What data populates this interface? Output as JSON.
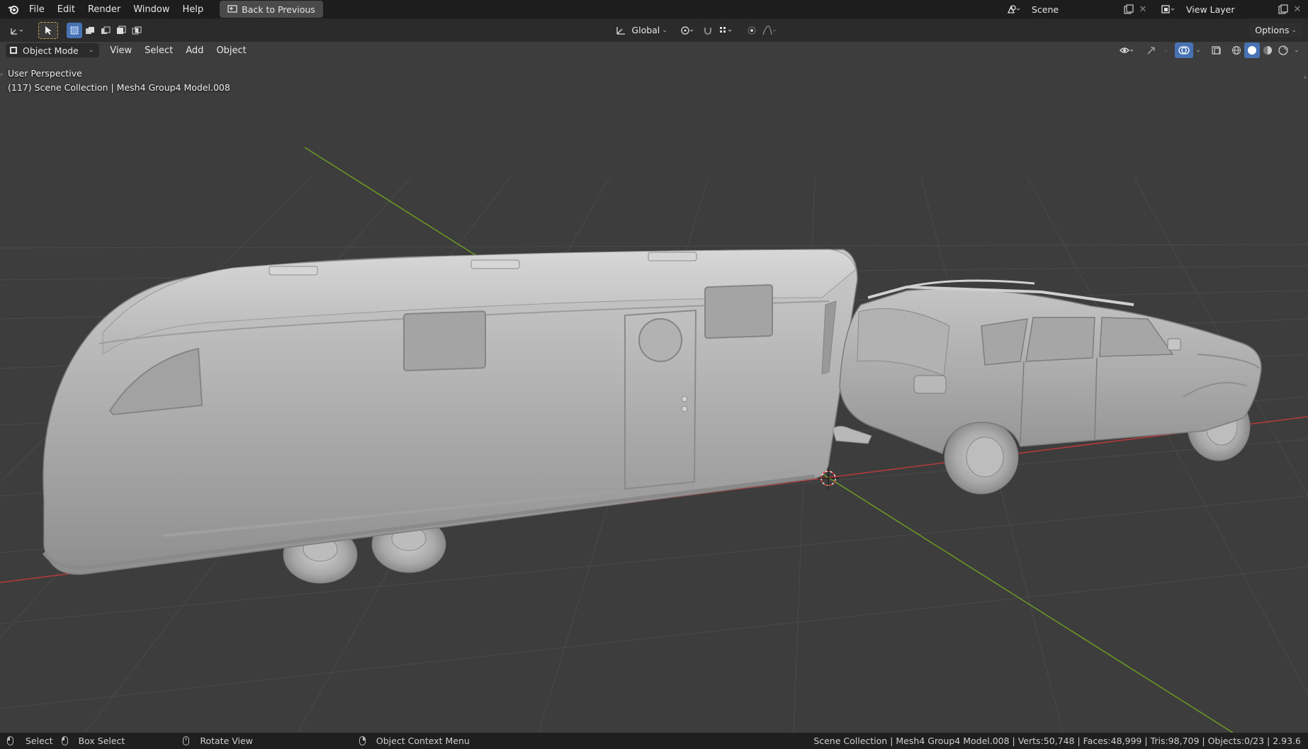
{
  "menu": {
    "items": [
      "File",
      "Edit",
      "Render",
      "Window",
      "Help"
    ],
    "back_button": "Back to Previous"
  },
  "scene": {
    "label": "Scene"
  },
  "view_layer": {
    "label": "View Layer"
  },
  "toolbar": {
    "orientation": "Global",
    "options": "Options"
  },
  "header": {
    "mode": "Object Mode",
    "menus": [
      "View",
      "Select",
      "Add",
      "Object"
    ]
  },
  "viewport": {
    "perspective": "User Perspective",
    "collection_info": "(117) Scene Collection | Mesh4 Group4 Model.008"
  },
  "status": {
    "select": "Select",
    "box_select": "Box Select",
    "rotate_view": "Rotate View",
    "context_menu": "Object Context Menu",
    "stats": "Scene Collection | Mesh4 Group4 Model.008 | Verts:50,748 | Faces:48,999 | Tris:98,709 | Objects:0/23 | 2.93.6"
  },
  "colors": {
    "accent": "#4772b3",
    "x_axis": "#b83a3a",
    "y_axis": "#6d9a23",
    "model": "#a7a7a7"
  }
}
